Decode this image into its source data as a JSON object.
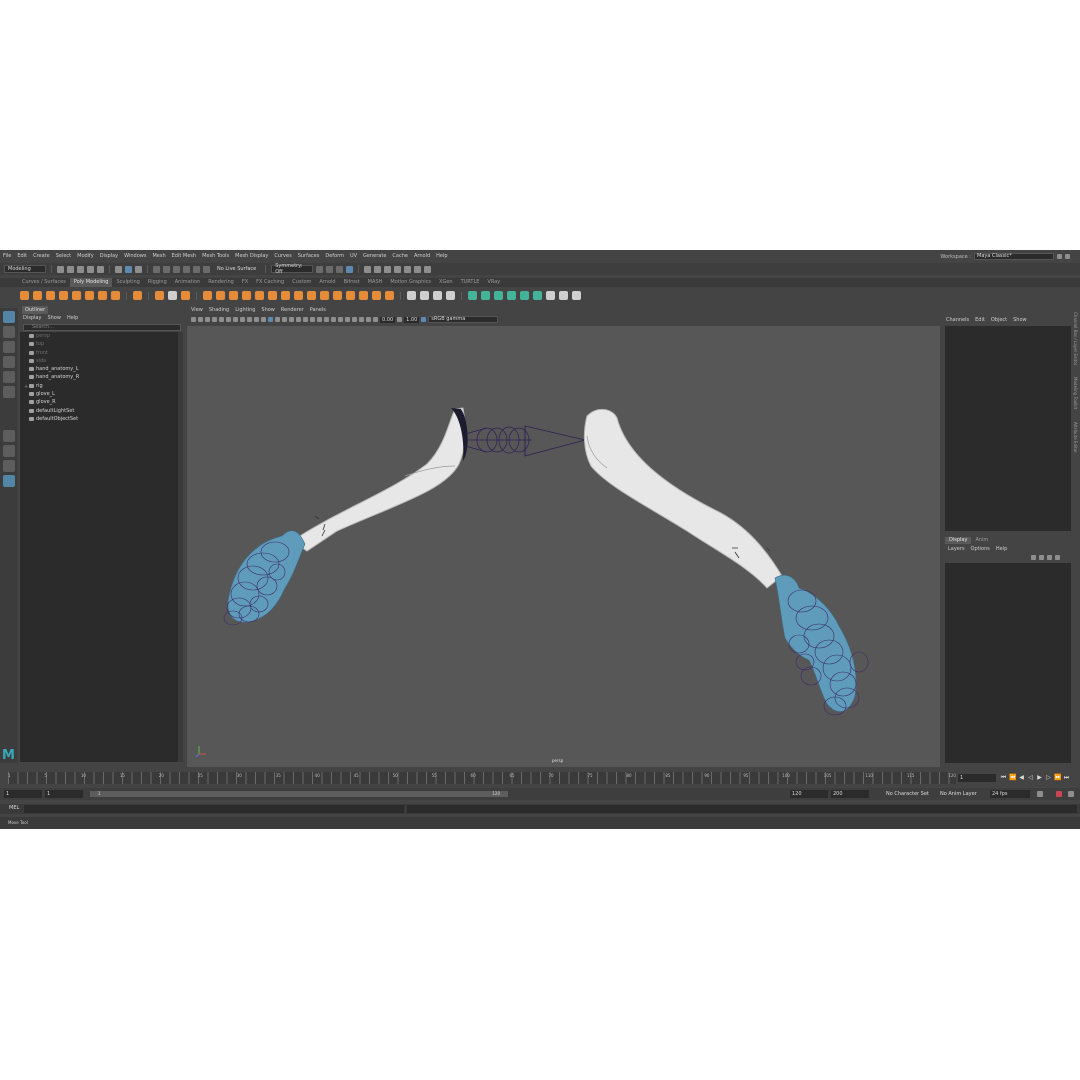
{
  "menubar": {
    "items": [
      "File",
      "Edit",
      "Create",
      "Select",
      "Modify",
      "Display",
      "Windows",
      "Mesh",
      "Edit Mesh",
      "Mesh Tools",
      "Mesh Display",
      "Curves",
      "Surfaces",
      "Deform",
      "UV",
      "Generate",
      "Cache",
      "Arnold",
      "Help"
    ],
    "workspace_label": "Workspace :",
    "workspace_value": "Maya Classic*"
  },
  "status_line": {
    "mode": "Modeling",
    "live_surface": "No Live Surface",
    "symmetry": "Symmetry: Off"
  },
  "shelf": {
    "tabs": [
      "Curves / Surfaces",
      "Poly Modeling",
      "Sculpting",
      "Rigging",
      "Animation",
      "Rendering",
      "FX",
      "FX Caching",
      "Custom",
      "Arnold",
      "Bifrost",
      "MASH",
      "Motion Graphics",
      "XGen",
      "TURTLE",
      "VRay"
    ],
    "active_tab": "Poly Modeling"
  },
  "outliner": {
    "tab": "Outliner",
    "menu": [
      "Display",
      "Show",
      "Help"
    ],
    "search_placeholder": "Search...",
    "items": [
      {
        "label": "persp",
        "dim": true
      },
      {
        "label": "top",
        "dim": true
      },
      {
        "label": "front",
        "dim": true
      },
      {
        "label": "side",
        "dim": true
      },
      {
        "label": "hand_anatomy_L",
        "dim": false
      },
      {
        "label": "hand_anatomy_R",
        "dim": false
      },
      {
        "label": "rig",
        "dim": false
      },
      {
        "label": "glove_L",
        "dim": false
      },
      {
        "label": "glove_R",
        "dim": false
      },
      {
        "label": "defaultLightSet",
        "dim": false
      },
      {
        "label": "defaultObjectSet",
        "dim": false
      }
    ]
  },
  "viewport": {
    "menu": [
      "View",
      "Shading",
      "Lighting",
      "Show",
      "Renderer",
      "Panels"
    ],
    "field_a": "0.00",
    "field_b": "1.00",
    "color_space": "sRGB gamma",
    "camera_label": "persp"
  },
  "channel_box": {
    "menu": [
      "Channels",
      "Edit",
      "Object",
      "Show"
    ],
    "vertical_tabs": [
      "Channel Box / Layer Editor",
      "Modeling Toolkit",
      "Attribute Editor"
    ]
  },
  "layer_editor": {
    "tabs": [
      "Display",
      "Anim"
    ],
    "active_tab": "Display",
    "menu": [
      "Layers",
      "Options",
      "Help"
    ]
  },
  "time_slider": {
    "ticks": [
      "1",
      "5",
      "10",
      "15",
      "20",
      "25",
      "30",
      "35",
      "40",
      "45",
      "50",
      "55",
      "60",
      "65",
      "70",
      "75",
      "80",
      "85",
      "90",
      "95",
      "100",
      "105",
      "110",
      "115",
      "120"
    ],
    "current_frame": "1"
  },
  "range_slider": {
    "start": "1",
    "anim_start": "1",
    "range_start_label": "1",
    "range_end_label": "120",
    "anim_end": "120",
    "end": "200",
    "character_set": "No Character Set",
    "anim_layer": "No Anim Layer",
    "fps": "24 fps"
  },
  "command_line": {
    "label": "MEL"
  },
  "help_line": {
    "text": "Move Tool"
  },
  "colors": {
    "glove": "#5f9bbb",
    "arm": "#e6e6e6",
    "rig": "#3d2a6b",
    "viewport_bg": "#575757"
  }
}
